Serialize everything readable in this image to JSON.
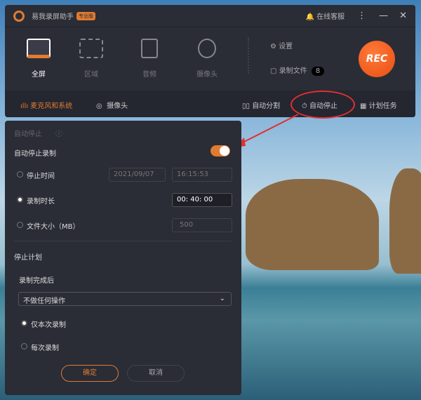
{
  "app": {
    "title": "易我录屏助手",
    "edition": "专业版",
    "support": "在线客服"
  },
  "modes": [
    {
      "label": "全屏"
    },
    {
      "label": "区域"
    },
    {
      "label": "音频"
    },
    {
      "label": "摄像头"
    }
  ],
  "side": {
    "settings": "设置",
    "files": "录制文件",
    "files_count": "8"
  },
  "rec": "REC",
  "toolbar": {
    "audio": "麦克风和系统",
    "camera": "摄像头",
    "split": "自动分割",
    "autostop": "自动停止",
    "schedule": "计划任务"
  },
  "panel": {
    "title": "自动停止",
    "toggle_label": "自动停止录制",
    "toggle_on": true,
    "stop_time": {
      "label": "停止时间",
      "date": "2021/09/07",
      "time": "16:15:53"
    },
    "duration": {
      "label": "录制时长",
      "value": "00: 40: 00"
    },
    "size": {
      "label": "文件大小（MB）",
      "value": "500"
    },
    "plan": "停止计划",
    "after": "录制完成后",
    "action": "不做任何操作",
    "once": "仅本次录制",
    "every": "每次录制",
    "ok": "确定",
    "cancel": "取消"
  },
  "colors": {
    "accent": "#e07b30",
    "rec": "#f05a1e"
  }
}
